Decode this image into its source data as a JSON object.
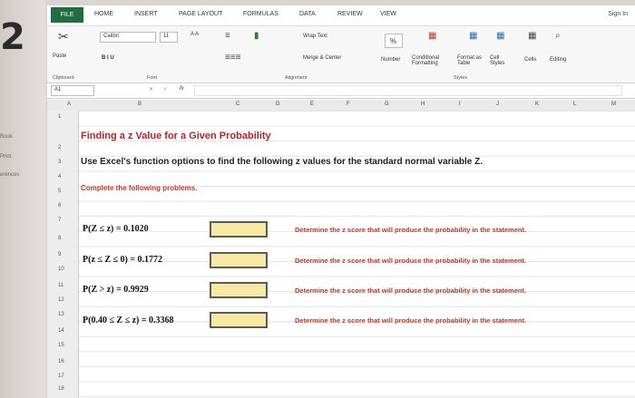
{
  "page_number": "2",
  "side_labels": [
    "Book",
    "Print",
    "erences"
  ],
  "ribbon_tabs": [
    "FILE",
    "HOME",
    "INSERT",
    "PAGE LAYOUT",
    "FORMULAS",
    "DATA",
    "REVIEW",
    "VIEW"
  ],
  "signin": "Sign In",
  "ribbon": {
    "paste": "Paste",
    "font_name": "Calibri",
    "font_size": "11",
    "format_buttons": "B I U",
    "wrap_text": "Wrap Text",
    "merge_center": "Merge & Center",
    "percent": "%",
    "number": "Number",
    "conditional": "Conditional Formatting",
    "format_table": "Format as Table",
    "cell_styles": "Cell Styles",
    "cells": "Cells",
    "editing": "Editing",
    "groups": [
      "Clipboard",
      "Font",
      "Alignment",
      "Styles"
    ]
  },
  "formula_bar": {
    "cell_ref": "A1",
    "fx": "fx",
    "value": ""
  },
  "columns": [
    "A",
    "B",
    "C",
    "D",
    "E",
    "F",
    "G",
    "H",
    "I",
    "J",
    "K",
    "L",
    "M"
  ],
  "rows": [
    "1",
    "2",
    "3",
    "4",
    "5",
    "6",
    "7",
    "8",
    "9",
    "10",
    "11",
    "12",
    "13",
    "14",
    "15",
    "16",
    "17",
    "18"
  ],
  "sheet": {
    "title": "Finding a z Value for a Given Probability",
    "instruction": "Use Excel's function options to find the following z values for the standard normal variable Z.",
    "subtitle": "Complete the following problems.",
    "problems": [
      {
        "label": "P(Z ≤ z) = 0.1020",
        "desc": "Determine the z score that will produce the probability in the statement."
      },
      {
        "label": "P(z ≤ Z ≤ 0) = 0.1772",
        "desc": "Determine the z score that will produce the probability in the statement."
      },
      {
        "label": "P(Z > z) = 0.9929",
        "desc": "Determine the z score that will produce the probability in the statement."
      },
      {
        "label": "P(0.40 ≤ Z ≤ z) = 0.3368",
        "desc": "Determine the z score that will produce the probability in the statement."
      }
    ]
  }
}
